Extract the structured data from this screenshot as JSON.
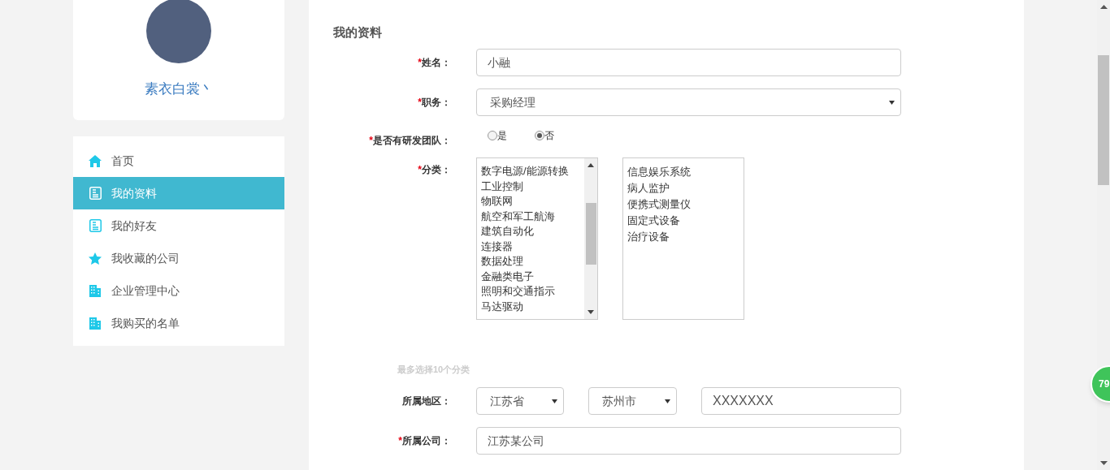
{
  "profile": {
    "username": "素衣白裳丶"
  },
  "menu": [
    {
      "label": "首页",
      "kind": "home",
      "selected": false
    },
    {
      "label": "我的资料",
      "kind": "doc",
      "selected": true
    },
    {
      "label": "我的好友",
      "kind": "doc",
      "selected": false
    },
    {
      "label": "我收藏的公司",
      "kind": "star",
      "selected": false
    },
    {
      "label": "企业管理中心",
      "kind": "building",
      "selected": false
    },
    {
      "label": "我购买的名单",
      "kind": "building",
      "selected": false
    }
  ],
  "form": {
    "title": "我的资料",
    "name": {
      "label": "姓名：",
      "required_mark": "*",
      "value": "小融"
    },
    "position": {
      "label": "职务：",
      "required_mark": "*",
      "value": "采购经理"
    },
    "rd_team": {
      "label": "是否有研发团队：",
      "required_mark": "*",
      "options": [
        {
          "label": "是",
          "selected": false
        },
        {
          "label": "否",
          "selected": true
        }
      ]
    },
    "category": {
      "label": "分类：",
      "required_mark": "*",
      "available": [
        "数字电源/能源转换",
        "工业控制",
        "物联网",
        "航空和军工航海",
        "建筑自动化",
        "连接器",
        "数据处理",
        "金融类电子",
        "照明和交通指示",
        "马达驱动"
      ],
      "chosen": [
        "信息娱乐系统",
        "病人监护",
        "便携式测量仪",
        "固定式设备",
        "治疗设备"
      ],
      "hint": "最多选择10个分类"
    },
    "region": {
      "label": "所属地区：",
      "province": "江苏省",
      "city": "苏州市",
      "detail": "XXXXXXX"
    },
    "company": {
      "label": "所属公司：",
      "required_mark": "*",
      "value": "江苏某公司"
    }
  },
  "floating_badge": "79"
}
